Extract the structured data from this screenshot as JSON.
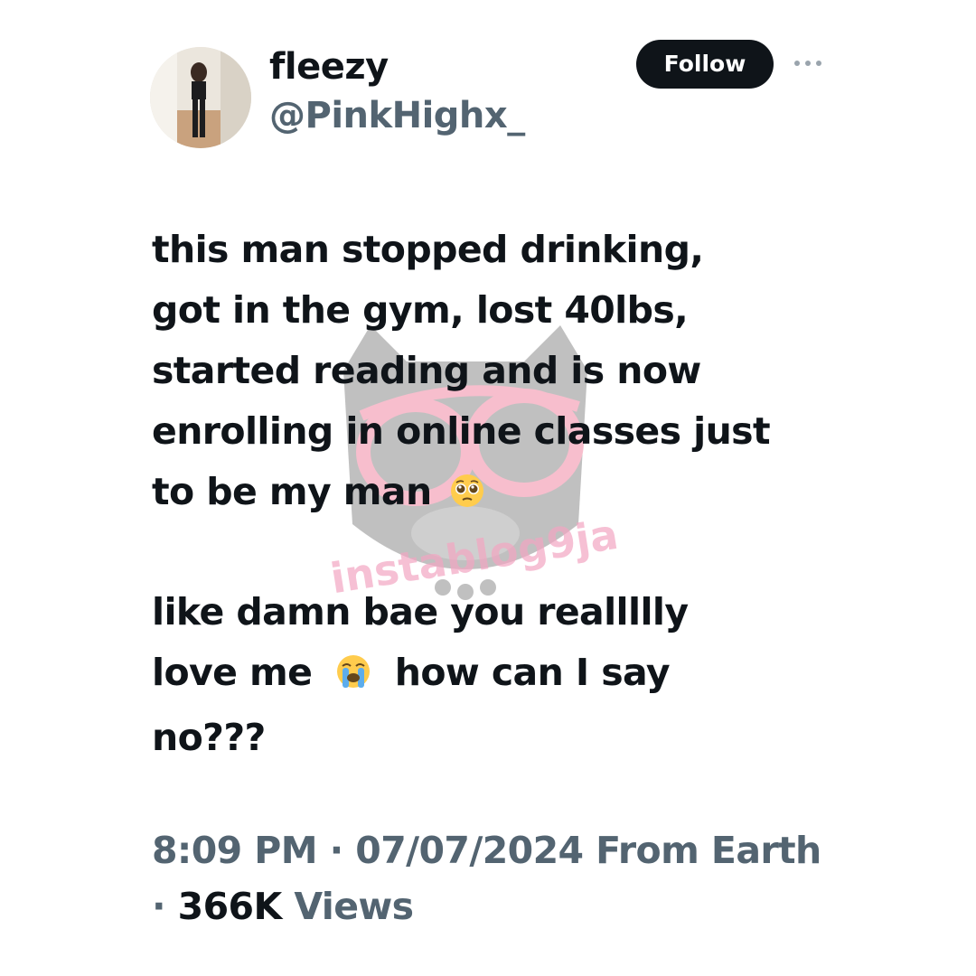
{
  "user": {
    "display_name": "fleezy",
    "handle": "@PinkHighx_"
  },
  "actions": {
    "follow_label": "Follow",
    "more_icon": "more-horizontal-icon"
  },
  "tweet": {
    "paragraph1": [
      "this man stopped drinking,",
      "got in the gym, lost 40lbs,",
      "started reading and is now",
      "enrolling in online classes just",
      "to be my man"
    ],
    "paragraph2": [
      "like damn bae you reallllly",
      "love me",
      "how can I say",
      "no???"
    ],
    "emoji1": "pleading-face-emoji",
    "emoji2": "loudly-crying-face-emoji"
  },
  "meta": {
    "time": "8:09 PM",
    "separator": "·",
    "date": "07/07/2024",
    "source": "From Earth",
    "views_count": "366K",
    "views_label": "Views"
  },
  "watermark": {
    "text": "instablog9ja"
  },
  "colors": {
    "text_primary": "#0f1419",
    "text_secondary": "#536471",
    "button_bg": "#0f1419",
    "button_text": "#ffffff"
  }
}
